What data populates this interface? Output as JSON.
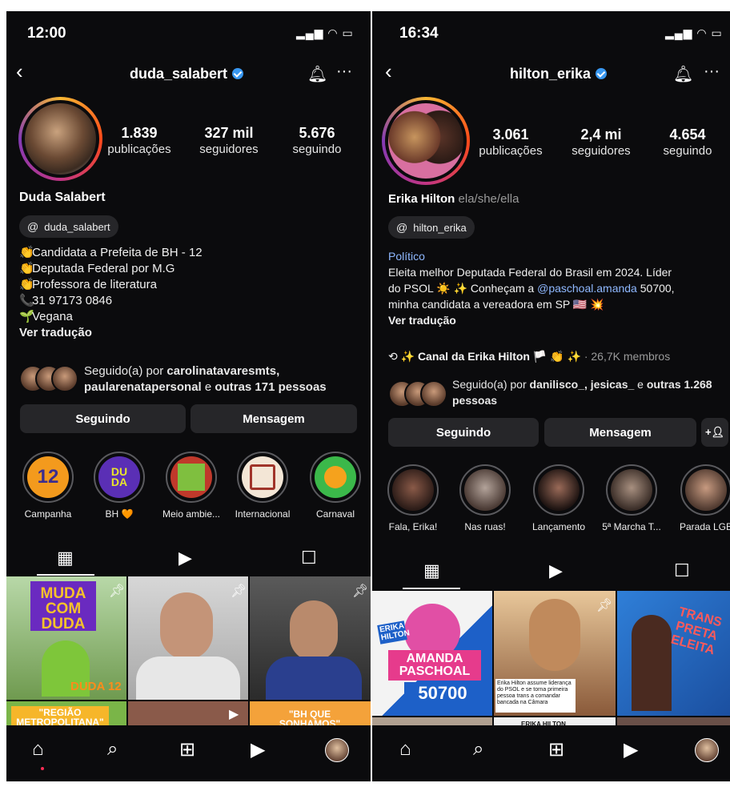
{
  "left": {
    "status": {
      "time": "12:00"
    },
    "header": {
      "username": "duda_salabert"
    },
    "stats": [
      {
        "value": "1.839",
        "label": "publicações"
      },
      {
        "value": "327 mil",
        "label": "seguidores"
      },
      {
        "value": "5.676",
        "label": "seguindo"
      }
    ],
    "name": "Duda Salabert",
    "threads_handle": "duda_salabert",
    "bio": [
      {
        "emoji": "👏",
        "text": "Candidata a Prefeita de BH - 12"
      },
      {
        "emoji": "👏",
        "text": "Deputada Federal por M.G"
      },
      {
        "emoji": "👏",
        "text": "Professora de literatura"
      },
      {
        "emoji": "📞",
        "text": "31 97173 0846"
      },
      {
        "emoji": "🌱",
        "text": "Vegana"
      }
    ],
    "translate": "Ver tradução",
    "followed_by": {
      "prefix": "Seguido(a) por ",
      "names": "carolinatavaresmts, paularenatapersonal",
      "middle": " e ",
      "others": "outras 171 pessoas"
    },
    "buttons": {
      "following": "Seguindo",
      "message": "Mensagem"
    },
    "highlights": [
      "Campanha",
      "BH 🧡",
      "Meio ambie...",
      "Internacional",
      "Carnaval"
    ],
    "posts": {
      "tile1": "MUDA COM DUDA",
      "tile1_badge": "DUDA 12",
      "tile4": "\"REGIÃO METROPOLITANA\"",
      "tile6": "\"BH QUE SONHAMOS\""
    }
  },
  "right": {
    "status": {
      "time": "16:34"
    },
    "header": {
      "username": "hilton_erika"
    },
    "stats": [
      {
        "value": "3.061",
        "label": "publicações"
      },
      {
        "value": "2,4 mi",
        "label": "seguidores"
      },
      {
        "value": "4.654",
        "label": "seguindo"
      }
    ],
    "name": "Erika Hilton",
    "pronouns": "ela/she/ella",
    "threads_handle": "hilton_erika",
    "category": "Político",
    "bio_l1": "Eleita melhor Deputada Federal do Brasil em 2024. Líder",
    "bio_l2a": "do PSOL ☀️ ✨ Conheçam a ",
    "bio_mention": "@paschoal.amanda",
    "bio_l2b": " 50700,",
    "bio_l3": "minha candidata a vereadora em SP 🇺🇸 💥",
    "translate": "Ver tradução",
    "channel": {
      "name": "✨ Canal da Erika Hilton 🏳️ 👏 ✨",
      "members": "· 26,7K membros"
    },
    "followed_by": {
      "prefix": "Seguido(a) por ",
      "names": "danilisco_, jesicas_",
      "middle": " e ",
      "others": "outras 1.268 pessoas"
    },
    "buttons": {
      "following": "Seguindo",
      "message": "Mensagem"
    },
    "highlights": [
      "Fala, Erika!",
      "Nas ruas!",
      "Lançamento",
      "5ª Marcha T...",
      "Parada LGB"
    ],
    "posts": {
      "tile1_name": "ERIKA HILTON",
      "tile1": "AMANDA PASCHOAL",
      "tile1_num": "50700",
      "tile2": "Erika Hilton assume liderança do PSOL e se torna primeira pessoa trans a comandar bancada na Câmara",
      "tile3": "TRANS PRETA ELEITA",
      "tile5": "ERIKA HILTON"
    }
  },
  "colors": {
    "bg": "#0b0b0d",
    "button": "#262629",
    "verified": "#3897f0",
    "link": "#8fb8ff"
  }
}
